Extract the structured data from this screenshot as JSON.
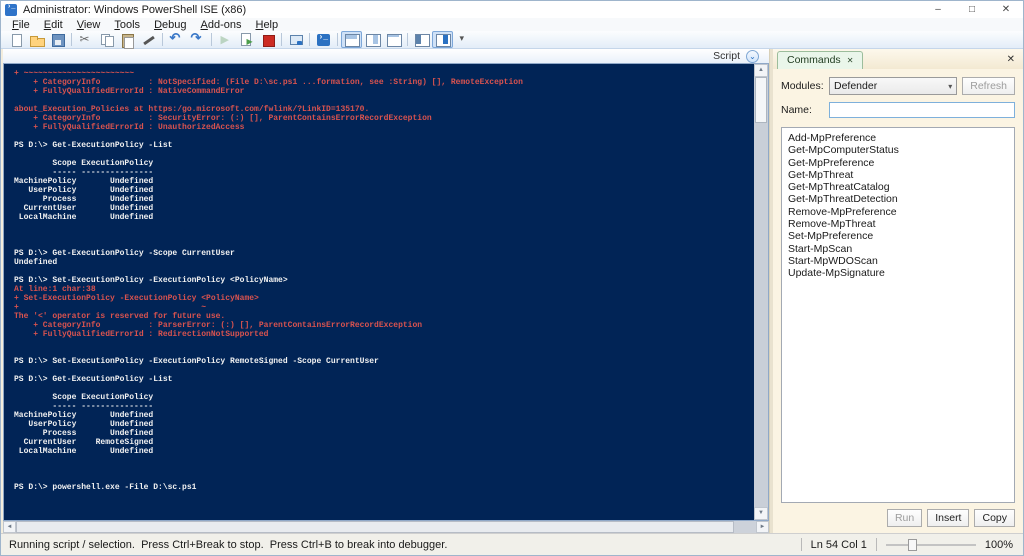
{
  "window": {
    "title": "Administrator: Windows PowerShell ISE (x86)"
  },
  "icons": {
    "minimize": "–",
    "maximize": "□",
    "close": "✕",
    "chevron_down": "⌄",
    "scroll_up": "▲",
    "scroll_down": "▼",
    "scroll_left": "◄",
    "scroll_right": "►",
    "dropdown_arrow": "▾"
  },
  "menu": {
    "items": [
      "File",
      "Edit",
      "View",
      "Tools",
      "Debug",
      "Add-ons",
      "Help"
    ]
  },
  "toolbar": {
    "buttons": [
      {
        "name": "new-script-button",
        "icon": "ic-new",
        "state": ""
      },
      {
        "name": "open-script-button",
        "icon": "ic-open",
        "state": ""
      },
      {
        "name": "save-script-button",
        "icon": "ic-save",
        "state": ""
      },
      {
        "sep": true
      },
      {
        "name": "cut-button",
        "icon": "ic-cut",
        "state": ""
      },
      {
        "name": "copy-button",
        "icon": "ic-copy",
        "state": ""
      },
      {
        "name": "paste-button",
        "icon": "ic-paste",
        "state": ""
      },
      {
        "name": "clear-console-pane-button",
        "icon": "ic-clear",
        "state": ""
      },
      {
        "sep": true
      },
      {
        "name": "undo-button",
        "icon": "ic-undo",
        "state": ""
      },
      {
        "name": "redo-button",
        "icon": "ic-redo",
        "state": ""
      },
      {
        "sep": true
      },
      {
        "name": "run-script-button",
        "icon": "ic-run",
        "state": "disabled"
      },
      {
        "name": "run-selection-button",
        "icon": "ic-runsel",
        "state": ""
      },
      {
        "name": "stop-operation-button",
        "icon": "ic-stop",
        "state": ""
      },
      {
        "sep": true
      },
      {
        "name": "new-remote-powershell-tab-button",
        "icon": "ic-remote",
        "state": ""
      },
      {
        "sep": true
      },
      {
        "name": "start-powershell-exe-button",
        "icon": "ic-ps",
        "state": ""
      },
      {
        "sep": true
      },
      {
        "name": "show-script-pane-top-button",
        "icon": "ic-pane-top",
        "state": "pressed"
      },
      {
        "name": "show-script-pane-right-button",
        "icon": "ic-pane-right",
        "state": ""
      },
      {
        "name": "show-script-pane-maximized-button",
        "icon": "ic-pane-max",
        "state": ""
      },
      {
        "sep": true
      },
      {
        "name": "show-command-window-button",
        "icon": "ic-addon-a",
        "state": ""
      },
      {
        "name": "show-command-addon-button",
        "icon": "ic-addon-b",
        "state": "pressed"
      },
      {
        "name": "toolbar-overflow-button",
        "icon": "ic-overflow",
        "state": ""
      }
    ]
  },
  "script_pane": {
    "label": "Script"
  },
  "console": {
    "lines": [
      {
        "t": "          ~~~~~~~~~~~~~~~~~~~~~~~~~~~~~~~~~~~~~",
        "cls": "err clip"
      },
      {
        "t": "+ ~~~~~~~~~~~~~~~~~~~~~~~",
        "cls": "err"
      },
      {
        "t": "    + CategoryInfo          : NotSpecified: (File D:\\sc.ps1 ...formation, see :String) [], RemoteException",
        "cls": "err"
      },
      {
        "t": "    + FullyQualifiedErrorId : NativeCommandError",
        "cls": "err"
      },
      {
        "t": "",
        "cls": ""
      },
      {
        "t": "about_Execution_Policies at https:/go.microsoft.com/fwlink/?LinkID=135170.",
        "cls": "err"
      },
      {
        "t": "    + CategoryInfo          : SecurityError: (:) [], ParentContainsErrorRecordException",
        "cls": "err"
      },
      {
        "t": "    + FullyQualifiedErrorId : UnauthorizedAccess",
        "cls": "err"
      },
      {
        "t": "",
        "cls": ""
      },
      {
        "t": "PS D:\\> Get-ExecutionPolicy -List",
        "cls": ""
      },
      {
        "t": "",
        "cls": ""
      },
      {
        "t": "        Scope ExecutionPolicy",
        "cls": ""
      },
      {
        "t": "        ----- ---------------",
        "cls": ""
      },
      {
        "t": "MachinePolicy       Undefined",
        "cls": ""
      },
      {
        "t": "   UserPolicy       Undefined",
        "cls": ""
      },
      {
        "t": "      Process       Undefined",
        "cls": ""
      },
      {
        "t": "  CurrentUser       Undefined",
        "cls": ""
      },
      {
        "t": " LocalMachine       Undefined",
        "cls": ""
      },
      {
        "t": "",
        "cls": ""
      },
      {
        "t": "",
        "cls": ""
      },
      {
        "t": "",
        "cls": ""
      },
      {
        "t": "PS D:\\> Get-ExecutionPolicy -Scope CurrentUser",
        "cls": ""
      },
      {
        "t": "Undefined",
        "cls": ""
      },
      {
        "t": "",
        "cls": ""
      },
      {
        "t": "PS D:\\> Set-ExecutionPolicy -ExecutionPolicy <PolicyName>",
        "cls": ""
      },
      {
        "t": "At line:1 char:38",
        "cls": "err"
      },
      {
        "t": "+ Set-ExecutionPolicy -ExecutionPolicy <PolicyName>",
        "cls": "err"
      },
      {
        "t": "+                                      ~",
        "cls": "err"
      },
      {
        "t": "The '<' operator is reserved for future use.",
        "cls": "err"
      },
      {
        "t": "    + CategoryInfo          : ParserError: (:) [], ParentContainsErrorRecordException",
        "cls": "err"
      },
      {
        "t": "    + FullyQualifiedErrorId : RedirectionNotSupported",
        "cls": "err"
      },
      {
        "t": "",
        "cls": ""
      },
      {
        "t": "",
        "cls": ""
      },
      {
        "t": "PS D:\\> Set-ExecutionPolicy -ExecutionPolicy RemoteSigned -Scope CurrentUser",
        "cls": ""
      },
      {
        "t": "",
        "cls": ""
      },
      {
        "t": "PS D:\\> Get-ExecutionPolicy -List",
        "cls": ""
      },
      {
        "t": "",
        "cls": ""
      },
      {
        "t": "        Scope ExecutionPolicy",
        "cls": ""
      },
      {
        "t": "        ----- ---------------",
        "cls": ""
      },
      {
        "t": "MachinePolicy       Undefined",
        "cls": ""
      },
      {
        "t": "   UserPolicy       Undefined",
        "cls": ""
      },
      {
        "t": "      Process       Undefined",
        "cls": ""
      },
      {
        "t": "  CurrentUser    RemoteSigned",
        "cls": ""
      },
      {
        "t": " LocalMachine       Undefined",
        "cls": ""
      },
      {
        "t": "",
        "cls": ""
      },
      {
        "t": "",
        "cls": ""
      },
      {
        "t": "",
        "cls": ""
      },
      {
        "t": "PS D:\\> powershell.exe -File D:\\sc.ps1",
        "cls": ""
      }
    ]
  },
  "commands_panel": {
    "tab_label": "Commands",
    "modules_label": "Modules:",
    "selected_module": "Defender",
    "refresh_button": "Refresh",
    "name_label": "Name:",
    "name_value": "",
    "commands": [
      "Add-MpPreference",
      "Get-MpComputerStatus",
      "Get-MpPreference",
      "Get-MpThreat",
      "Get-MpThreatCatalog",
      "Get-MpThreatDetection",
      "Remove-MpPreference",
      "Remove-MpThreat",
      "Set-MpPreference",
      "Start-MpScan",
      "Start-MpWDOScan",
      "Update-MpSignature"
    ],
    "run_button": "Run",
    "insert_button": "Insert",
    "copy_button": "Copy"
  },
  "status_bar": {
    "message": "Running script / selection.  Press Ctrl+Break to stop.  Press Ctrl+B to break into debugger.",
    "cursor_position": "Ln 54 Col 1",
    "zoom_level": "100%"
  },
  "colors": {
    "console_bg": "#012456",
    "console_text": "#F2F2F2",
    "console_error": "#D9534F",
    "accent_blue": "#2B71C2",
    "panel_bg": "#FBF4E3",
    "tab_green": "#EAF6EA"
  }
}
